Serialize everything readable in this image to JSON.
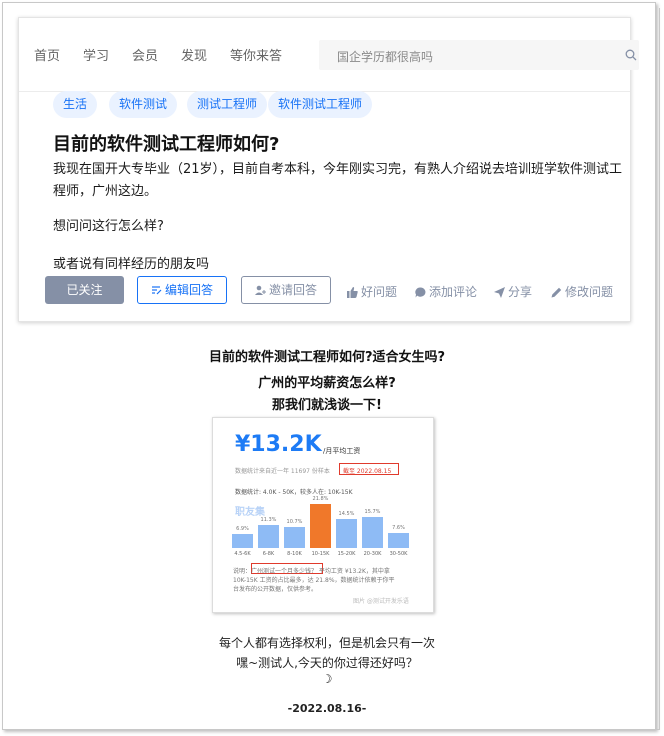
{
  "nav": {
    "items": [
      "首页",
      "学习",
      "会员",
      "发现",
      "等你来答"
    ],
    "search_placeholder": "国企学历都很高吗"
  },
  "question": {
    "tags": [
      "生活",
      "软件测试",
      "测试工程师",
      "软件测试工程师"
    ],
    "title": "目前的软件测试工程师如何?",
    "body_lines": [
      "我现在国开大专毕业（21岁），目前自考本科，今年刚实习完，有熟人介绍说去培训班学软件测试工",
      "程师，广州这边。",
      "想问问这行怎么样?",
      "或者说有同样经历的朋友吗"
    ],
    "actions": {
      "follow": "已关注",
      "edit_answer": "编辑回答",
      "invite": "邀请回答",
      "good_question": "好问题",
      "add_comment": "添加评论",
      "share": "分享",
      "edit_question": "修改问题"
    }
  },
  "article": {
    "headline_lines": [
      "目前的软件测试工程师如何?适合女生吗?",
      "广州的平均薪资怎么样?",
      "那我们就浅谈一下!"
    ],
    "salary": {
      "amount": "¥13.2K",
      "unit": "/月平均工资",
      "meta": "数据统计来自近一年 11697 份样本",
      "meta_box": "截至 2022.08.15",
      "range": "数据统计: 4.0K - 50K，较多人在: 10K-15K",
      "brand": "职友集",
      "note_line1": "说明：广州测试一个月多少钱？ 平均工资 ¥13.2K，其中拿",
      "note_line2": "10K-15K 工资的占比最多，达 21.8%，数据统计依赖于你平",
      "note_line3": "台发布的公开数据，仅供参考。",
      "watermark": "图片 @测试开发乐语"
    },
    "footer_lines": [
      "每个人都有选择权利，但是机会只有一次",
      "嘿~测试人,今天的你过得还好吗？",
      "☽"
    ],
    "date": "-2022.08.16-"
  },
  "chart_data": {
    "type": "bar",
    "title": "",
    "categories": [
      "4.5-6K",
      "6-8K",
      "8-10K",
      "10-15K",
      "15-20K",
      "20-30K",
      "30-50K"
    ],
    "values": [
      6.9,
      11.3,
      10.7,
      21.8,
      14.5,
      15.7,
      7.6
    ],
    "highlight_index": 3,
    "colors": {
      "bar": "#8ebbf5",
      "highlight": "#f0782a"
    },
    "ylim": [
      0,
      25
    ]
  }
}
